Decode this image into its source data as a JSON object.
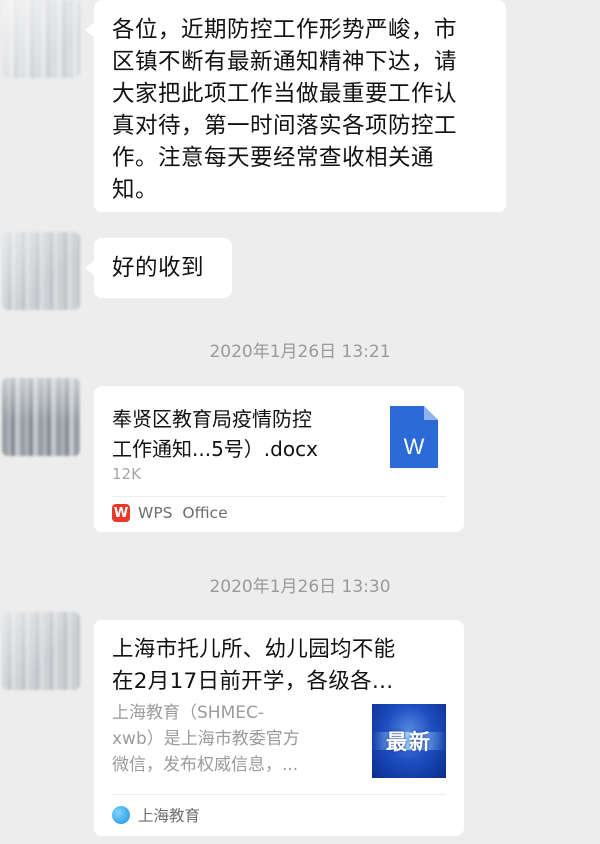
{
  "messages": [
    {
      "type": "text",
      "lines": [
        "各位，近期防控工作形势严峻，市",
        "区镇不断有最新通知精神下达，请",
        "大家把此项工作当做最重要工作认",
        "真对待，第一时间落实各项防控工",
        "作。注意每天要经常查收相关通",
        "知。"
      ]
    },
    {
      "type": "text",
      "lines": [
        "好的收到"
      ]
    }
  ],
  "timestamps": [
    "2020年1月26日 13:21",
    "2020年1月26日 13:30"
  ],
  "file_card": {
    "name_lines": [
      "奉贤区教育局疫情防控",
      "工作通知...5号）.docx"
    ],
    "size": "12K",
    "icon": "word-document-icon",
    "app_label": "WPS  Office",
    "app_icon_letter": "W"
  },
  "article_card": {
    "title_lines": [
      "上海市托儿所、幼儿园均不能",
      "在2月17日前开学，各级各..."
    ],
    "desc_lines": [
      "上海教育（SHMEC-",
      "xwb）是上海市教委官方",
      "微信，发布权威信息，..."
    ],
    "thumb_text": "最新",
    "source": "上海教育"
  },
  "colors": {
    "background": "#ededed",
    "bubble": "#ffffff",
    "wps_red": "#e8382a",
    "word_blue": "#2b6bd6"
  }
}
